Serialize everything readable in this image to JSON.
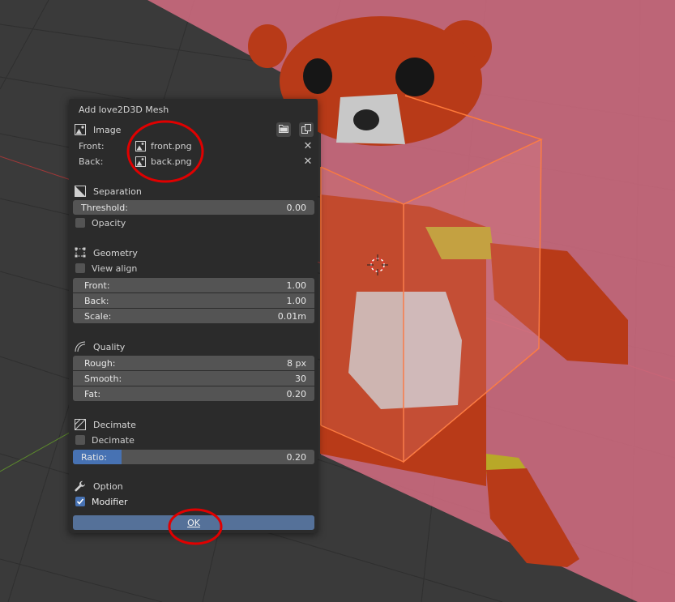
{
  "panel": {
    "title": "Add love2D3D Mesh",
    "image": {
      "label": "Image",
      "front_key": "Front:",
      "front_value": "front.png",
      "back_key": "Back:",
      "back_value": "back.png"
    },
    "separation": {
      "label": "Separation",
      "threshold_key": "Threshold:",
      "threshold_value": "0.00",
      "opacity_label": "Opacity",
      "opacity_checked": false
    },
    "geometry": {
      "label": "Geometry",
      "view_align_label": "View align",
      "view_align_checked": false,
      "front_key": "Front:",
      "front_value": "1.00",
      "back_key": "Back:",
      "back_value": "1.00",
      "scale_key": "Scale:",
      "scale_value": "0.01m"
    },
    "quality": {
      "label": "Quality",
      "rough_key": "Rough:",
      "rough_value": "8 px",
      "smooth_key": "Smooth:",
      "smooth_value": "30",
      "fat_key": "Fat:",
      "fat_value": "0.20"
    },
    "decimate": {
      "label": "Decimate",
      "decimate_check_label": "Decimate",
      "decimate_checked": false,
      "ratio_key": "Ratio:",
      "ratio_value": "0.20",
      "ratio_fraction": 0.2
    },
    "option": {
      "label": "Option",
      "modifier_label": "Modifier",
      "modifier_checked": true
    },
    "ok_label": "OK"
  },
  "icons": {
    "image_section": "image-icon",
    "open_folder": "folder-open-icon",
    "copy": "copy-icon",
    "file": "image-file-icon",
    "clear": "close-icon",
    "separation": "separation-icon",
    "geometry": "geometry-icon",
    "quality": "quality-icon",
    "decimate": "decimate-icon",
    "option": "wrench-icon",
    "object_origin": "origin-cursor-icon"
  },
  "colors": {
    "panel_bg": "#2b2b2b",
    "field_bg": "#545454",
    "accent": "#4772b3",
    "ok_button": "#557199",
    "annotation": "#e00000",
    "mesh_plane": "#d67084",
    "teddy_red": "#b83a18"
  }
}
